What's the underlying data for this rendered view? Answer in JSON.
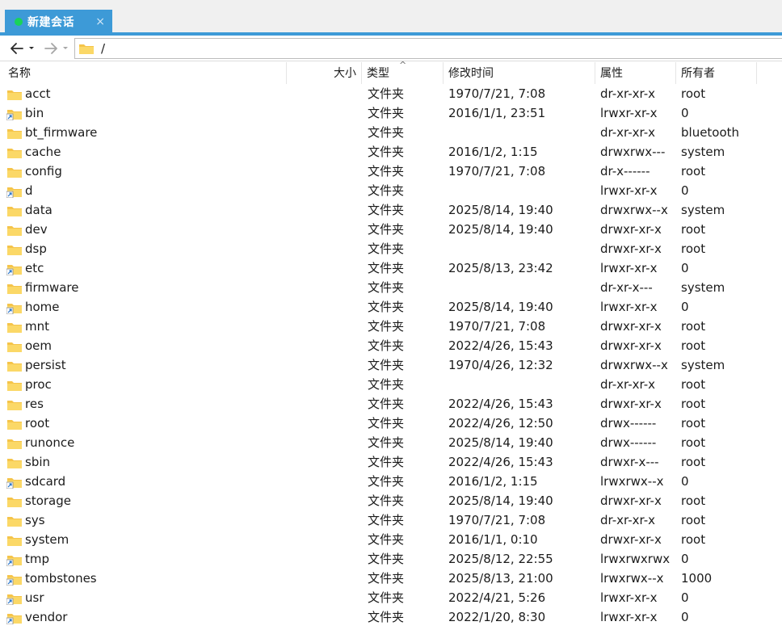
{
  "tab": {
    "title": "新建会话",
    "close": "×"
  },
  "address": {
    "path": "/"
  },
  "columns": {
    "name": "名称",
    "size": "大小",
    "type": "类型",
    "time": "修改时间",
    "attr": "属性",
    "owner": "所有者"
  },
  "sort_indicator": "^",
  "rows": [
    {
      "name": "acct",
      "link": false,
      "type": "文件夹",
      "time": "1970/7/21, 7:08",
      "attr": "dr-xr-xr-x",
      "owner": "root"
    },
    {
      "name": "bin",
      "link": true,
      "type": "文件夹",
      "time": "2016/1/1, 23:51",
      "attr": "lrwxr-xr-x",
      "owner": "0"
    },
    {
      "name": "bt_firmware",
      "link": false,
      "type": "文件夹",
      "time": "",
      "attr": "dr-xr-xr-x",
      "owner": "bluetooth"
    },
    {
      "name": "cache",
      "link": false,
      "type": "文件夹",
      "time": "2016/1/2, 1:15",
      "attr": "drwxrwx---",
      "owner": "system"
    },
    {
      "name": "config",
      "link": false,
      "type": "文件夹",
      "time": "1970/7/21, 7:08",
      "attr": "dr-x------",
      "owner": "root"
    },
    {
      "name": "d",
      "link": true,
      "type": "文件夹",
      "time": "",
      "attr": "lrwxr-xr-x",
      "owner": "0"
    },
    {
      "name": "data",
      "link": false,
      "type": "文件夹",
      "time": "2025/8/14, 19:40",
      "attr": "drwxrwx--x",
      "owner": "system"
    },
    {
      "name": "dev",
      "link": false,
      "type": "文件夹",
      "time": "2025/8/14, 19:40",
      "attr": "drwxr-xr-x",
      "owner": "root"
    },
    {
      "name": "dsp",
      "link": false,
      "type": "文件夹",
      "time": "",
      "attr": "drwxr-xr-x",
      "owner": "root"
    },
    {
      "name": "etc",
      "link": true,
      "type": "文件夹",
      "time": "2025/8/13, 23:42",
      "attr": "lrwxr-xr-x",
      "owner": "0"
    },
    {
      "name": "firmware",
      "link": false,
      "type": "文件夹",
      "time": "",
      "attr": "dr-xr-x---",
      "owner": "system"
    },
    {
      "name": "home",
      "link": true,
      "type": "文件夹",
      "time": "2025/8/14, 19:40",
      "attr": "lrwxr-xr-x",
      "owner": "0"
    },
    {
      "name": "mnt",
      "link": false,
      "type": "文件夹",
      "time": "1970/7/21, 7:08",
      "attr": "drwxr-xr-x",
      "owner": "root"
    },
    {
      "name": "oem",
      "link": false,
      "type": "文件夹",
      "time": "2022/4/26, 15:43",
      "attr": "drwxr-xr-x",
      "owner": "root"
    },
    {
      "name": "persist",
      "link": false,
      "type": "文件夹",
      "time": "1970/4/26, 12:32",
      "attr": "drwxrwx--x",
      "owner": "system"
    },
    {
      "name": "proc",
      "link": false,
      "type": "文件夹",
      "time": "",
      "attr": "dr-xr-xr-x",
      "owner": "root"
    },
    {
      "name": "res",
      "link": false,
      "type": "文件夹",
      "time": "2022/4/26, 15:43",
      "attr": "drwxr-xr-x",
      "owner": "root"
    },
    {
      "name": "root",
      "link": false,
      "type": "文件夹",
      "time": "2022/4/26, 12:50",
      "attr": "drwx------",
      "owner": "root"
    },
    {
      "name": "runonce",
      "link": false,
      "type": "文件夹",
      "time": "2025/8/14, 19:40",
      "attr": "drwx------",
      "owner": "root"
    },
    {
      "name": "sbin",
      "link": false,
      "type": "文件夹",
      "time": "2022/4/26, 15:43",
      "attr": "drwxr-x---",
      "owner": "root"
    },
    {
      "name": "sdcard",
      "link": true,
      "type": "文件夹",
      "time": "2016/1/2, 1:15",
      "attr": "lrwxrwx--x",
      "owner": "0"
    },
    {
      "name": "storage",
      "link": false,
      "type": "文件夹",
      "time": "2025/8/14, 19:40",
      "attr": "drwxr-xr-x",
      "owner": "root"
    },
    {
      "name": "sys",
      "link": false,
      "type": "文件夹",
      "time": "1970/7/21, 7:08",
      "attr": "dr-xr-xr-x",
      "owner": "root"
    },
    {
      "name": "system",
      "link": false,
      "type": "文件夹",
      "time": "2016/1/1, 0:10",
      "attr": "drwxr-xr-x",
      "owner": "root"
    },
    {
      "name": "tmp",
      "link": true,
      "type": "文件夹",
      "time": "2025/8/12, 22:55",
      "attr": "lrwxrwxrwx",
      "owner": "0"
    },
    {
      "name": "tombstones",
      "link": true,
      "type": "文件夹",
      "time": "2025/8/13, 21:00",
      "attr": "lrwxrwx--x",
      "owner": "1000"
    },
    {
      "name": "usr",
      "link": true,
      "type": "文件夹",
      "time": "2022/4/21, 5:26",
      "attr": "lrwxr-xr-x",
      "owner": "0"
    },
    {
      "name": "vendor",
      "link": true,
      "type": "文件夹",
      "time": "2022/1/20, 8:30",
      "attr": "lrwxr-xr-x",
      "owner": "0"
    }
  ],
  "colors": {
    "accent": "#3d9ad7",
    "status_dot": "#19d35a",
    "folder": "#f5c44a"
  },
  "icons": {
    "back": "arrow-left-icon",
    "forward": "arrow-right-icon",
    "folder": "folder-icon",
    "link_folder": "folder-shortcut-icon"
  }
}
